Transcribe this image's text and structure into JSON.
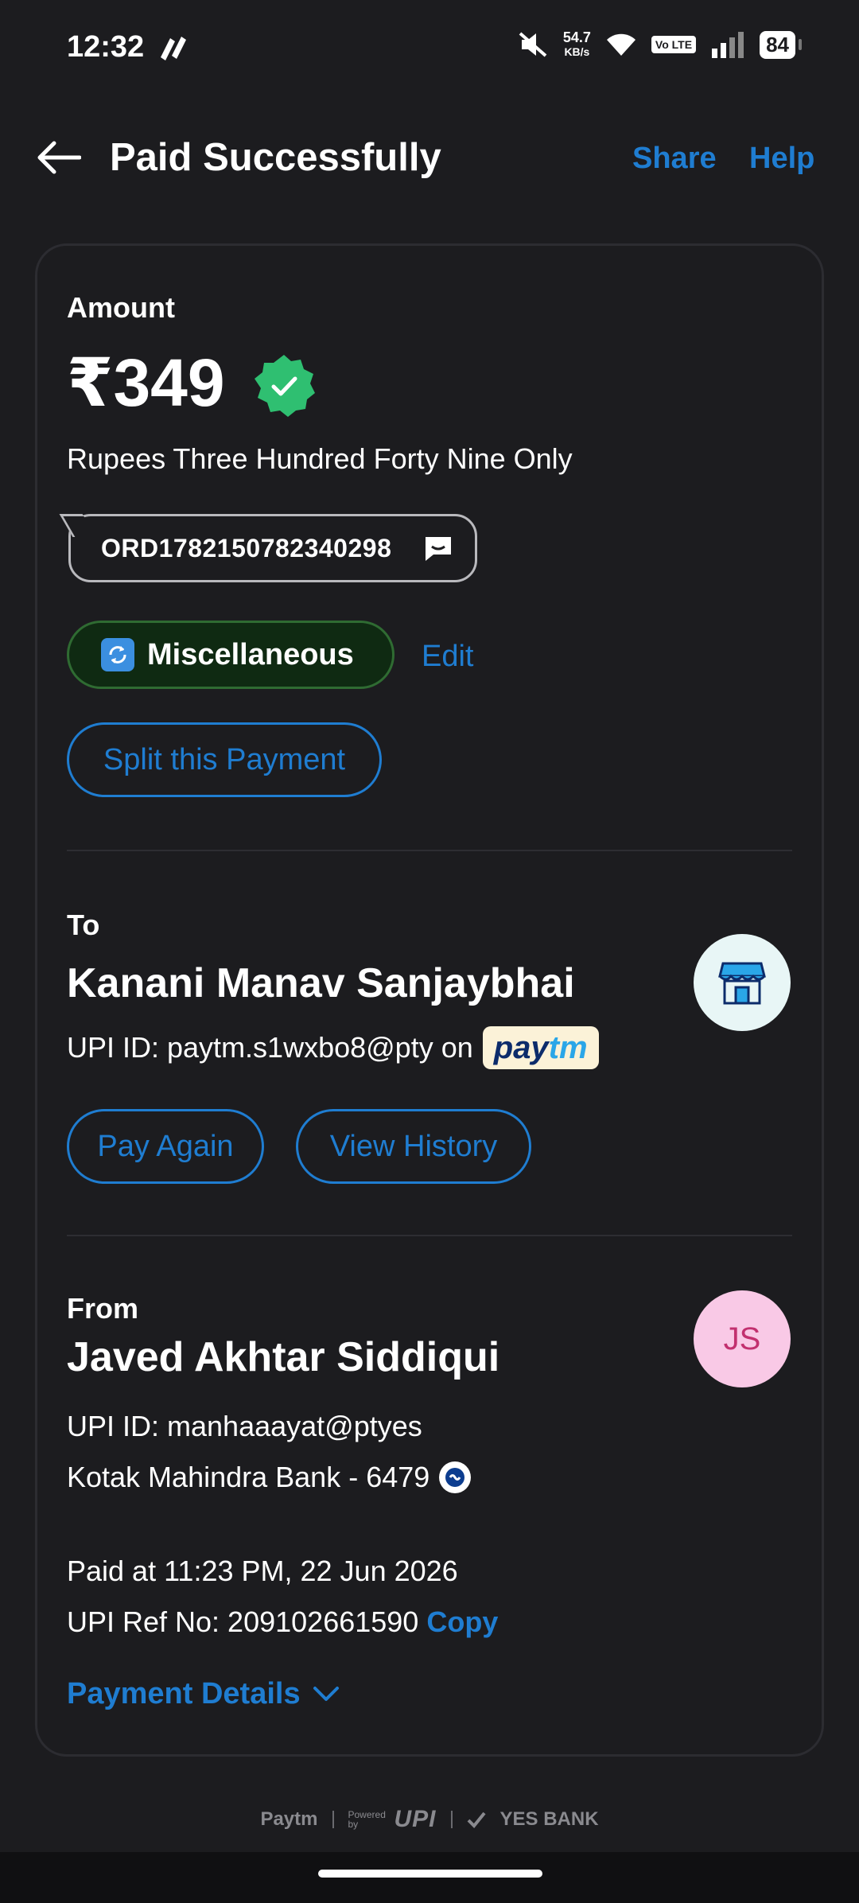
{
  "status_bar": {
    "time": "12:32",
    "net_speed": "54.7",
    "net_unit": "KB/s",
    "volte": "Vo LTE",
    "battery": "84"
  },
  "header": {
    "title": "Paid Successfully",
    "share": "Share",
    "help": "Help"
  },
  "amount": {
    "label": "Amount",
    "value": "₹349",
    "words": "Rupees Three Hundred Forty Nine Only",
    "order_id": "ORD1782150782340298",
    "category": "Miscellaneous",
    "edit": "Edit",
    "split": "Split this Payment"
  },
  "to": {
    "label": "To",
    "name": "Kanani Manav Sanjaybhai",
    "upi_prefix": "UPI ID: paytm.s1wxbo8@pty on",
    "paytm_brand_a": "pay",
    "paytm_brand_b": "tm",
    "pay_again": "Pay Again",
    "view_history": "View History"
  },
  "from": {
    "label": "From",
    "name": "Javed Akhtar Siddiqui",
    "initials": "JS",
    "upi": "UPI ID: manhaaayat@ptyes",
    "bank": "Kotak Mahindra Bank - 6479"
  },
  "transaction": {
    "paid_at": "Paid at 11:23 PM, 22 Jun 2026",
    "ref_prefix": "UPI Ref No: 209102661590",
    "copy": "Copy",
    "details": "Payment Details"
  },
  "footer": {
    "paytm": "Paytm",
    "powered": "Powered by",
    "upi": "UPI",
    "bank": "YES BANK"
  },
  "colors": {
    "background": "#1c1c1f",
    "accent": "#1f7dd1",
    "success": "#2fbf71"
  }
}
